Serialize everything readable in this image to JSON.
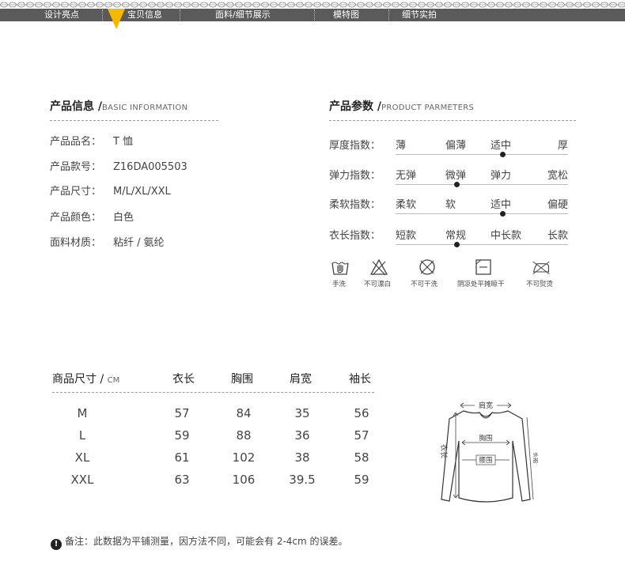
{
  "nav": {
    "items": [
      "设计亮点",
      "宝贝信息",
      "面料/细节展示",
      "模特图",
      "细节实拍"
    ],
    "band_color": "#5a5a5a",
    "pointer_color": "#f5b800"
  },
  "product_info": {
    "title": "产品信息 /",
    "subtitle": "BASIC INFORMATION",
    "rows": [
      {
        "label": "产品品名：",
        "value": "T 恤"
      },
      {
        "label": "产品款号：",
        "value": "Z16DA005503"
      },
      {
        "label": "产品尺寸：",
        "value": "M/L/XL/XXL"
      },
      {
        "label": "产品颜色：",
        "value": "白色"
      },
      {
        "label": "面料材质：",
        "value": "粘纤 / 氨纶"
      }
    ]
  },
  "product_params": {
    "title": "产品参数 /",
    "subtitle": "PRODUCT PARMETERS",
    "rows": [
      {
        "label": "厚度指数：",
        "options": [
          "薄",
          "偏薄",
          "适中",
          "厚"
        ],
        "selected": 2
      },
      {
        "label": "弹力指数：",
        "options": [
          "无弹",
          "微弹",
          "弹力",
          "宽松"
        ],
        "selected": 1
      },
      {
        "label": "柔软指数：",
        "options": [
          "柔软",
          "软",
          "适中",
          "偏硬"
        ],
        "selected": 2
      },
      {
        "label": "衣长指数：",
        "options": [
          "短款",
          "常规",
          "中长款",
          "长款"
        ],
        "selected": 1
      }
    ],
    "care": [
      {
        "icon": "hand-wash-icon",
        "label": "手洗"
      },
      {
        "icon": "no-bleach-icon",
        "label": "不可漂白"
      },
      {
        "icon": "no-tumble-dry-icon",
        "label": "不可干洗"
      },
      {
        "icon": "shade-flat-dry-icon",
        "label": "阴凉处平摊晾干"
      },
      {
        "icon": "no-iron-icon",
        "label": "不可熨烫"
      }
    ]
  },
  "size_table": {
    "title": "商品尺寸 /",
    "unit": "CM",
    "columns": [
      "衣长",
      "胸围",
      "肩宽",
      "袖长"
    ],
    "rows": [
      {
        "size": "M",
        "values": [
          "57",
          "84",
          "35",
          "56"
        ]
      },
      {
        "size": "L",
        "values": [
          "59",
          "88",
          "36",
          "57"
        ]
      },
      {
        "size": "XL",
        "values": [
          "61",
          "102",
          "38",
          "58"
        ]
      },
      {
        "size": "XXL",
        "values": [
          "63",
          "106",
          "39.5",
          "59"
        ]
      }
    ]
  },
  "diagram": {
    "shoulder": "肩宽",
    "chest": "胸围",
    "waist": "腰围",
    "length": "衣长",
    "sleeve": "长袖"
  },
  "note": "备注：此数据为平铺测量，因方法不同，可能会有 2-4cm 的误差。"
}
